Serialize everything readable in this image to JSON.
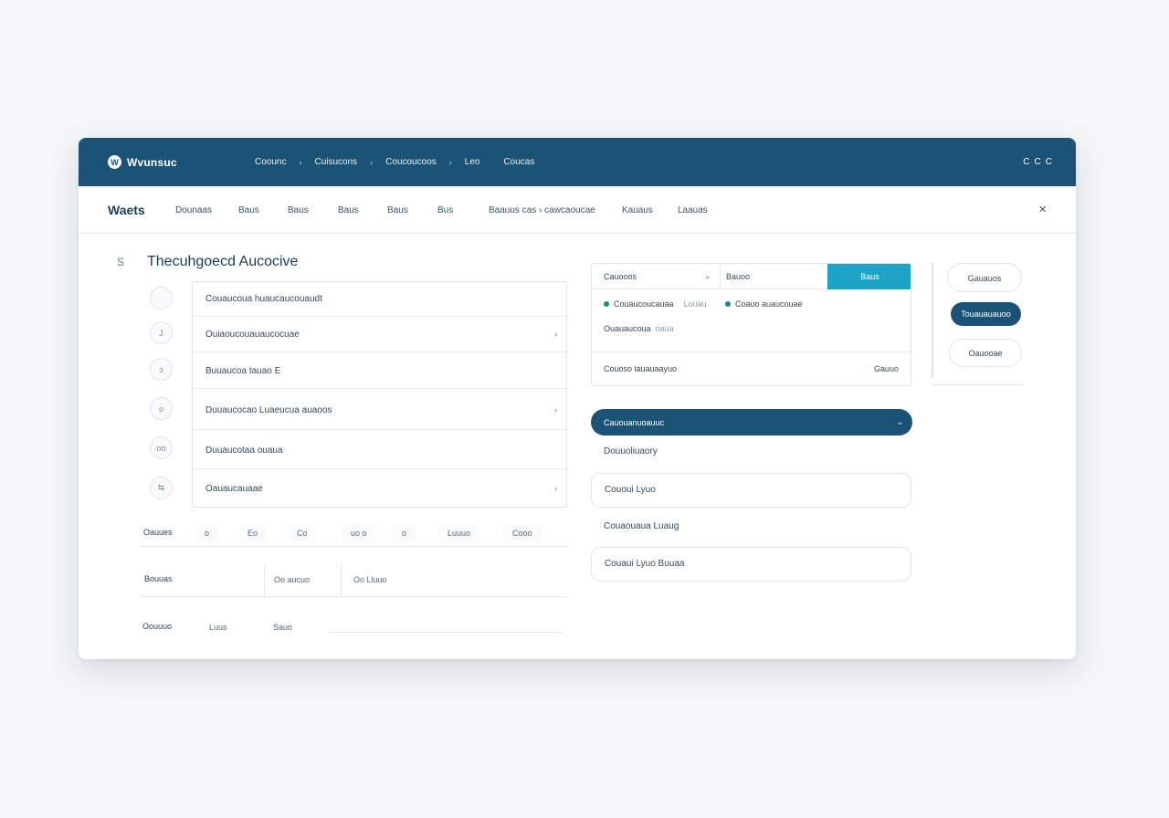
{
  "topbar": {
    "brand_name": "Wvunsuc",
    "logo_glyph": "W",
    "nav": [
      "Coounc",
      "Cuisucons",
      "Coucoucoos",
      "Leo",
      "Coucas"
    ],
    "nav_separator": "›",
    "actions": [
      "C",
      "C",
      "C"
    ]
  },
  "toolbar": {
    "title": "Waets",
    "tabs": [
      "Dounaas",
      "Baus",
      "Baus",
      "Baus",
      "Baus",
      "Bus",
      "Baauus cas › cawcaoucae",
      "Kauaus",
      "Laauas"
    ],
    "close_glyph": "×"
  },
  "section": {
    "icon": "S",
    "title": "Thecuhgoecd Aucocive"
  },
  "steps": [
    "",
    "J",
    "ↄ",
    "o",
    "oo",
    "⇆"
  ],
  "form_rows": [
    {
      "label": "Couaucoua huaucaucouaudt",
      "chevron": ""
    },
    {
      "label": "Ouiaoucouauaucocuae",
      "chevron": "›"
    },
    {
      "label": "Buuaucoa tauao E",
      "chevron": ""
    },
    {
      "label": "Duuaucocao Luaeucua auaoos",
      "chevron": "›"
    },
    {
      "label": "Duuaucotaa ouaua",
      "chevron": ""
    },
    {
      "label": "Oauaucauaae",
      "chevron": "›"
    }
  ],
  "lower": {
    "row1_label": "Oauues",
    "row1_cells": [
      "o",
      "Eo",
      "Co",
      "uo o",
      "o",
      "Luuuo",
      "Cooo"
    ],
    "row2_label": "Bouuas",
    "row2_cells": [
      "Oo aucuo",
      "Oo Lluuo"
    ],
    "row3_label": "Oouuuo",
    "row3_cells": [
      "Luus",
      "Sauo"
    ]
  },
  "filter_card": {
    "select_label": "Cauooos",
    "select_chevron": "⌄",
    "field_label": "Bauoo",
    "button_label": "Baus",
    "chips": [
      {
        "label": "Couaucoucauaa",
        "extra": "Louau"
      },
      {
        "label": "Coauo auaucouae",
        "extra": ""
      }
    ],
    "sub_label": "Ouauaucoua",
    "sub_extra": "oaua",
    "footer_left": "Couoso lauauaayuo",
    "footer_right": "Gauuo"
  },
  "side_actions": [
    "Gauauos",
    "Touauauauoo",
    "Oauooae"
  ],
  "dropdown": {
    "label": "Cauouanuoauuc",
    "chevron": "⌄"
  },
  "options": [
    {
      "label": "Douuoliuaory",
      "boxed": false
    },
    {
      "label": "Cououi Lyuo",
      "boxed": true
    },
    {
      "label": "Couaouaua Luaug",
      "boxed": false
    },
    {
      "label": "Couaui Lyuo Buuaa",
      "boxed": true
    }
  ]
}
